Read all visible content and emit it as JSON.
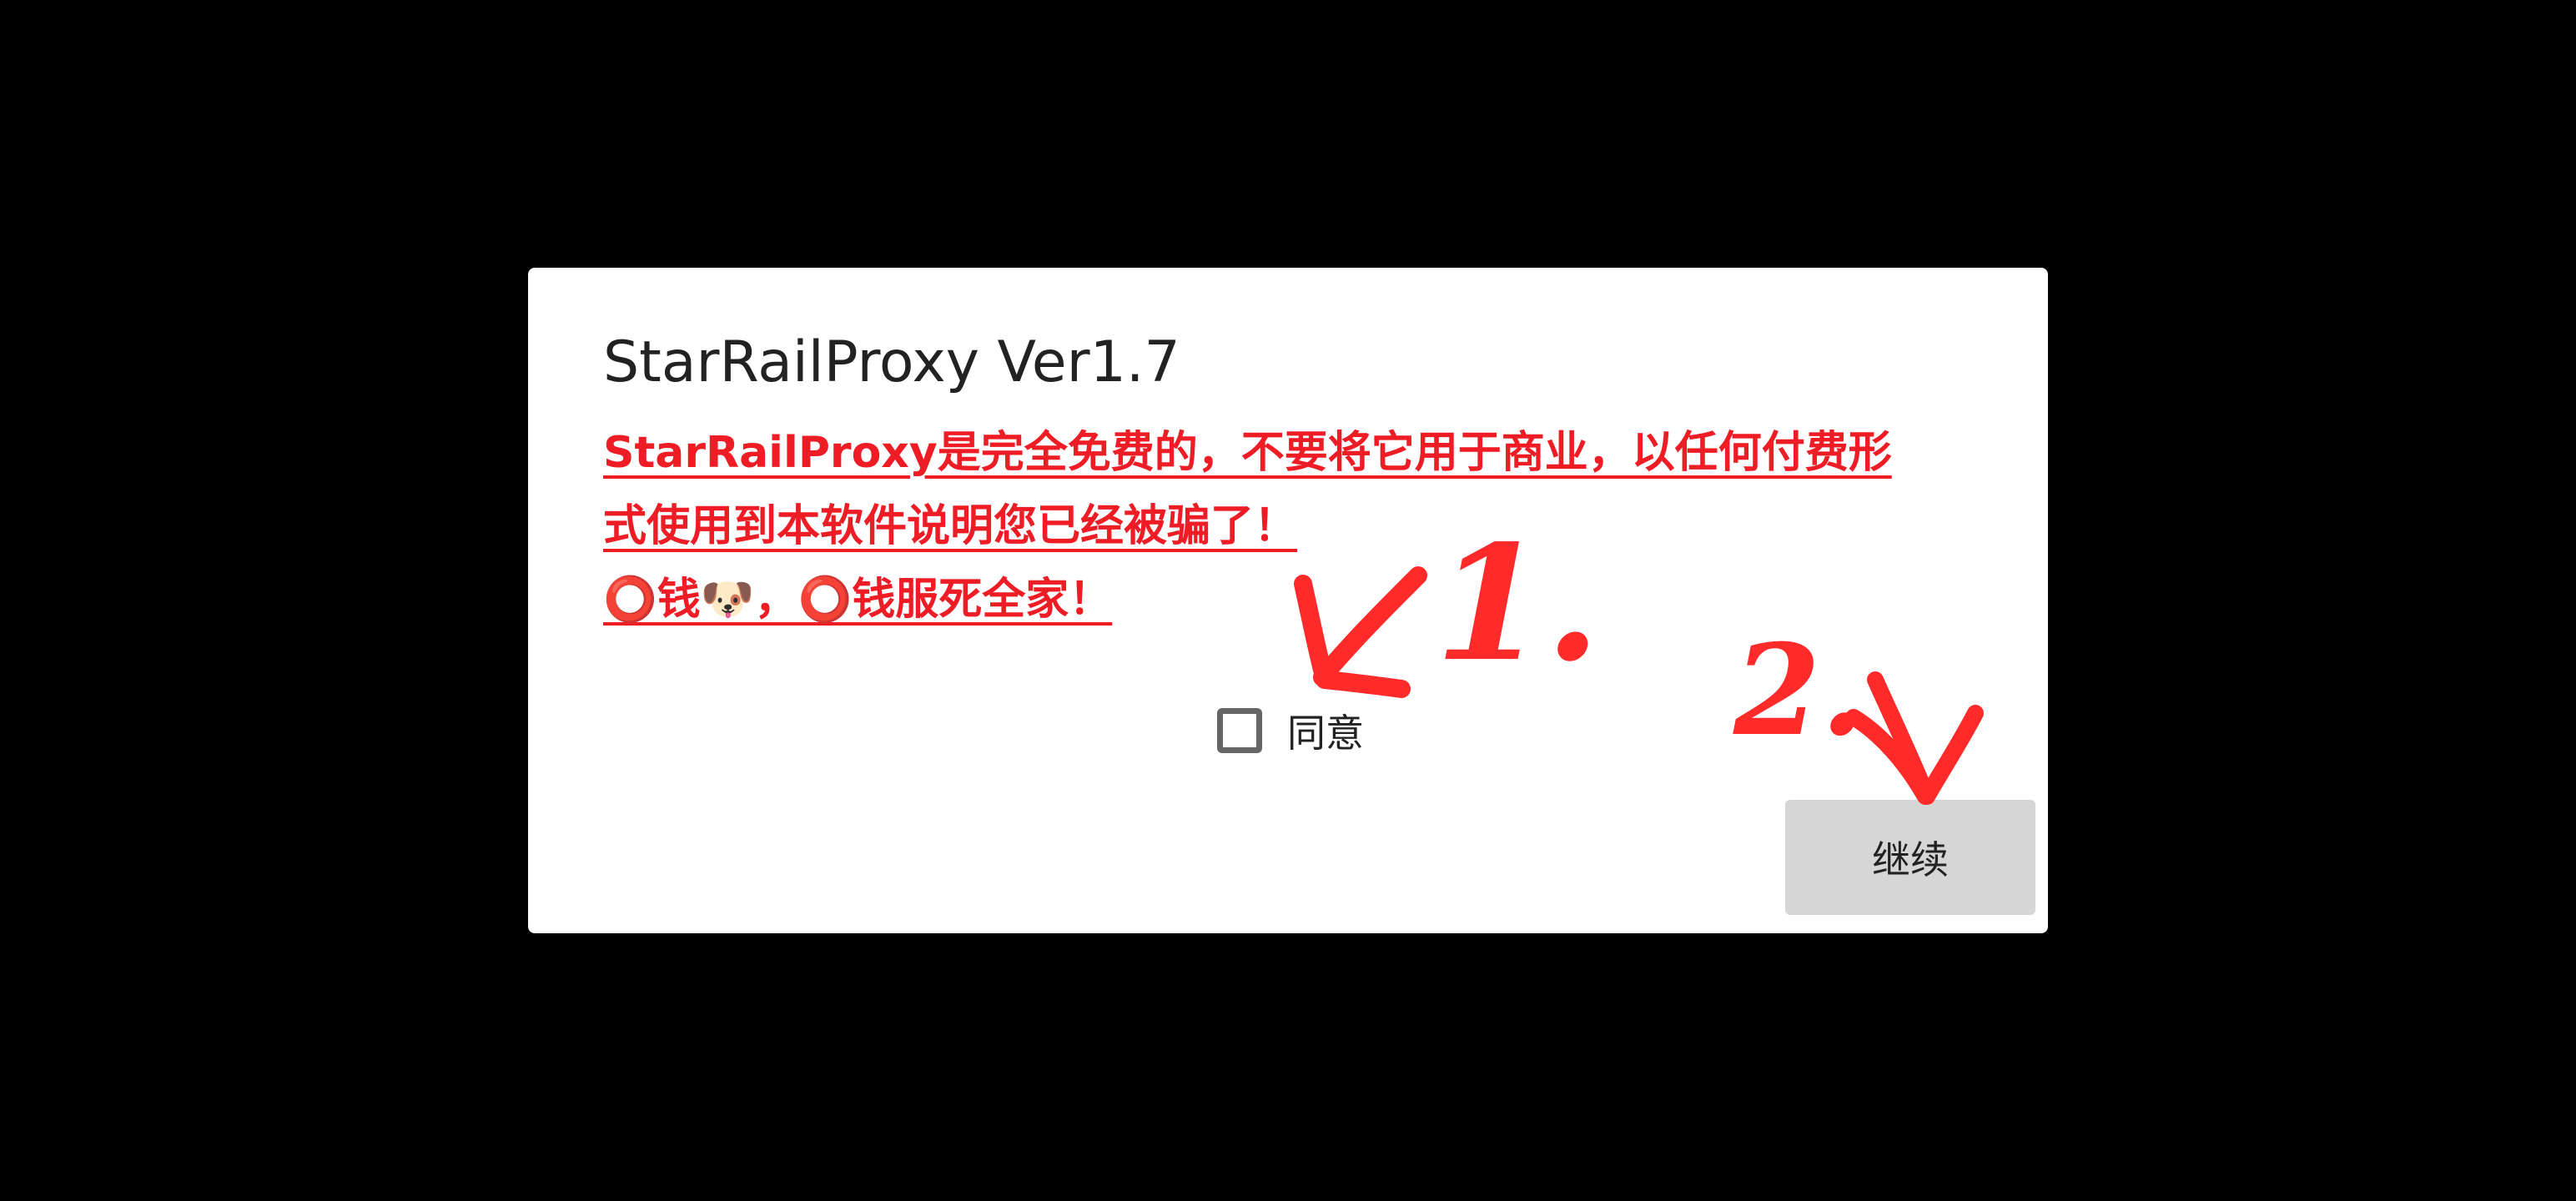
{
  "dialog": {
    "title": "StarRailProxy Ver1.7",
    "warning_line1": "StarRailProxy是完全免费的，不要将它用于商业，以任何付费形",
    "warning_line2": "式使用到本软件说明您已经被骗了！",
    "warning_line3": "⭕钱🐶，⭕钱服死全家！",
    "agree_label": "同意",
    "agree_checked": false,
    "continue_label": "继续"
  },
  "annotations": {
    "step1": "1.",
    "step2": "2.",
    "color": "#ff2a2a"
  },
  "colors": {
    "background": "#000000",
    "dialog": "#ffffff",
    "warning_text": "#ee1c25",
    "button": "#d6d6d6"
  }
}
